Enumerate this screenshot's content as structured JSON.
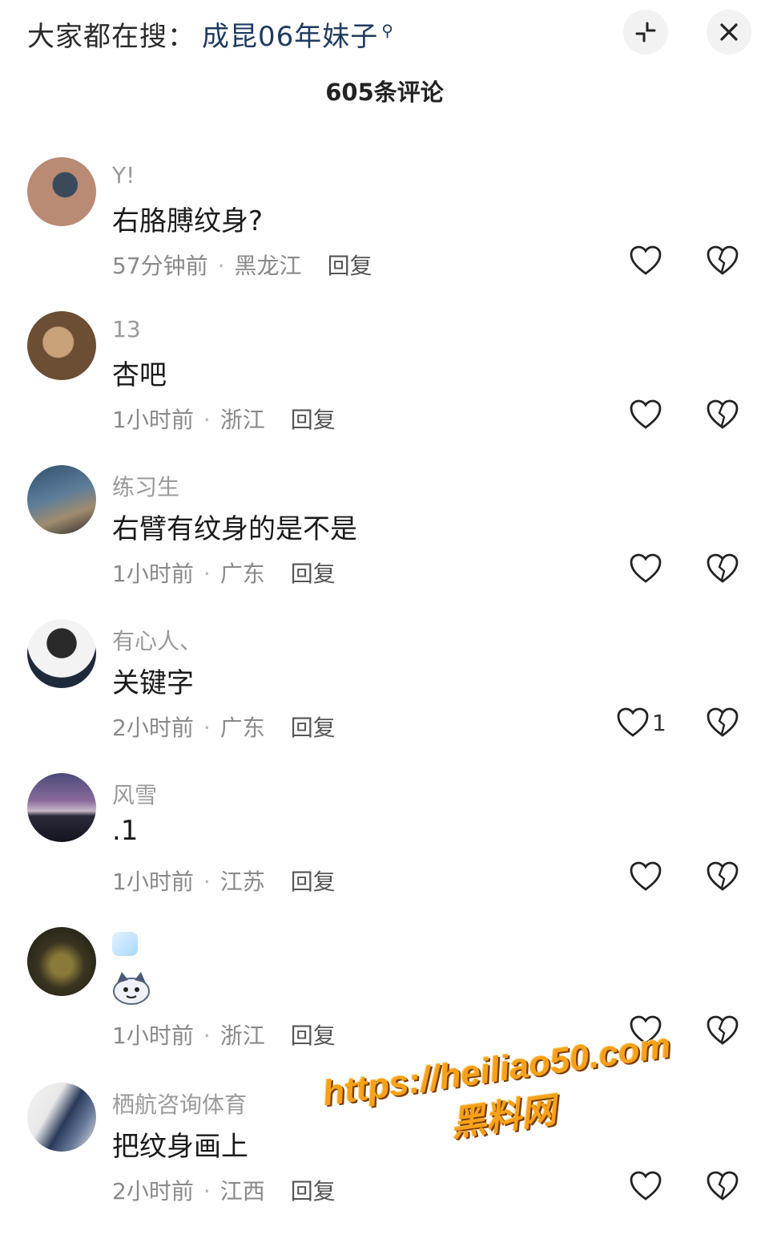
{
  "header": {
    "search_prefix": "大家都在搜：",
    "search_term": "成昆06年妹子",
    "search_glyph": "⚲"
  },
  "title": "605条评论",
  "comments": [
    {
      "user": "Y!",
      "text": "右胳膊纹身?",
      "time": "57分钟前",
      "region": "黑龙江",
      "reply": "回复",
      "likes": ""
    },
    {
      "user": "13",
      "text": "杏吧",
      "time": "1小时前",
      "region": "浙江",
      "reply": "回复",
      "likes": ""
    },
    {
      "user": "练习生",
      "text": "右臂有纹身的是不是",
      "time": "1小时前",
      "region": "广东",
      "reply": "回复",
      "likes": ""
    },
    {
      "user": "有心人、",
      "text": "关键字",
      "time": "2小时前",
      "region": "广东",
      "reply": "回复",
      "likes": "1"
    },
    {
      "user": "风雪",
      "text": ".1",
      "time": "1小时前",
      "region": "江苏",
      "reply": "回复",
      "likes": ""
    },
    {
      "user": "",
      "text": "",
      "time": "1小时前",
      "region": "浙江",
      "reply": "回复",
      "likes": ""
    },
    {
      "user": "栖航咨询体育",
      "text": "把纹身画上",
      "time": "2小时前",
      "region": "江西",
      "reply": "回复",
      "likes": ""
    }
  ],
  "watermark": {
    "url": "https://heiliao50.com",
    "name": "黑料网",
    "color": "#f7a11a"
  }
}
